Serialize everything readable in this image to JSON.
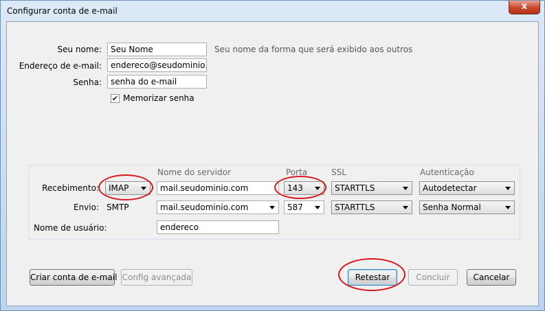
{
  "window": {
    "title": "Configurar conta de e-mail",
    "close_label": "x"
  },
  "identity": {
    "name_label": "Seu nome:",
    "name_value": "Seu Nome",
    "name_hint": "Seu nome da forma que será exibido aos outros",
    "email_label": "Endereço de e-mail:",
    "email_value": "endereco@seudominio.com",
    "password_label": "Senha:",
    "password_value": "senha do e-mail",
    "remember_label": "Memorizar senha",
    "remember_checked": true
  },
  "server": {
    "headers": {
      "server": "Nome do servidor",
      "port": "Porta",
      "ssl": "SSL",
      "auth": "Autenticação"
    },
    "incoming": {
      "label": "Recebimento:",
      "protocol": "IMAP",
      "server": "mail.seudominio.com",
      "port": "143",
      "ssl": "STARTTLS",
      "auth": "Autodetectar"
    },
    "outgoing": {
      "label": "Envio:",
      "protocol": "SMTP",
      "server": "mail.seudominio.com",
      "port": "587",
      "ssl": "STARTTLS",
      "auth": "Senha Normal"
    },
    "username_label": "Nome de usuário:",
    "username_value": "endereco"
  },
  "buttons": {
    "create": "Criar conta de e-mail",
    "advanced": "Config avançada",
    "retest": "Retestar",
    "done": "Concluir",
    "cancel": "Cancelar"
  },
  "colors": {
    "highlight_circle": "#d9151c"
  }
}
